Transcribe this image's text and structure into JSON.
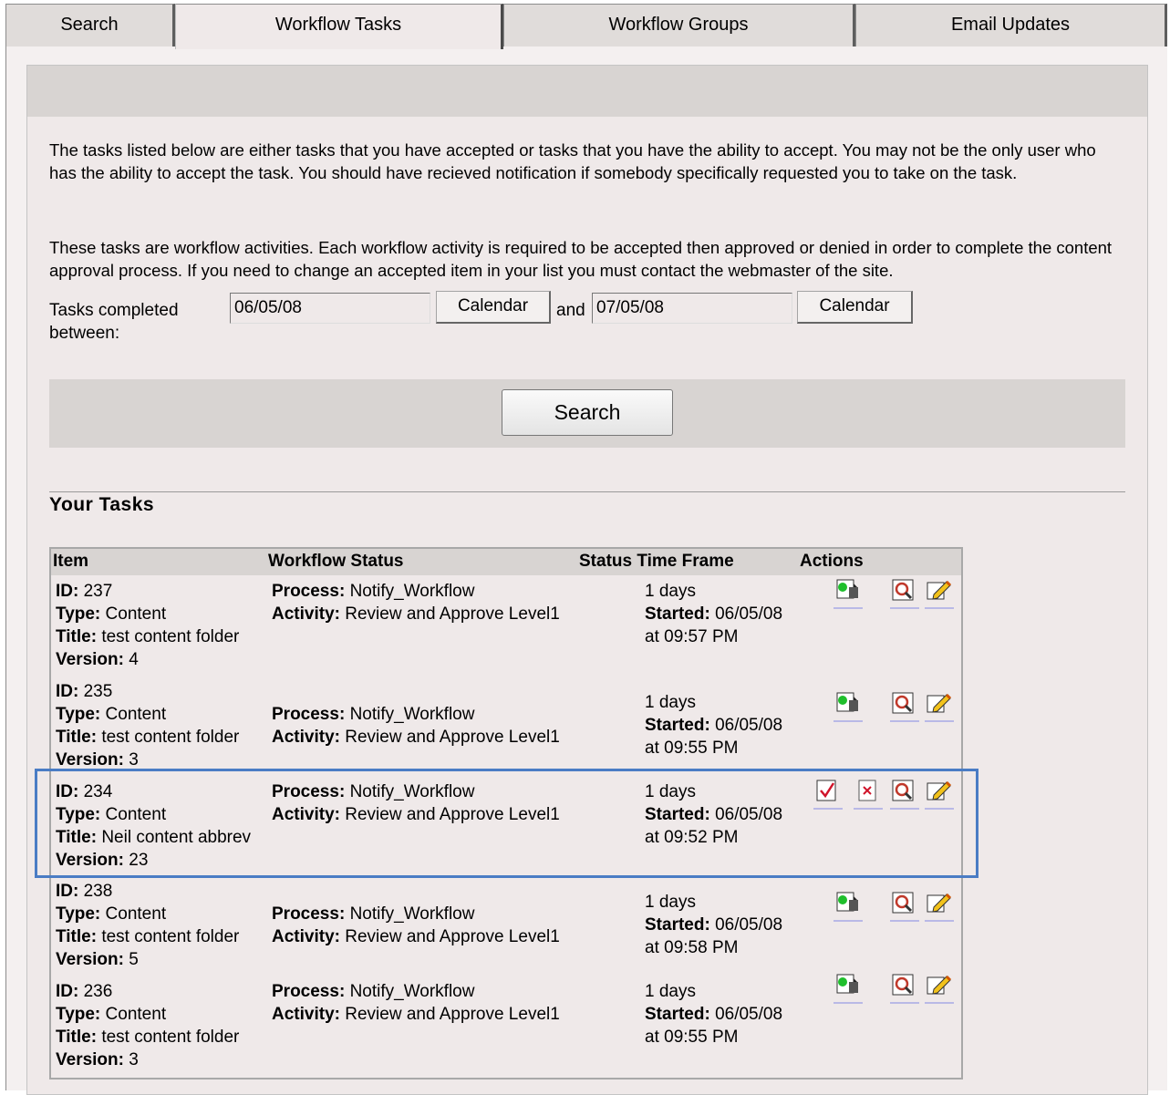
{
  "tabs": [
    {
      "label": "Search",
      "active": false
    },
    {
      "label": "Workflow Tasks",
      "active": true
    },
    {
      "label": "Workflow Groups",
      "active": false
    },
    {
      "label": "Email Updates",
      "active": false
    }
  ],
  "intro": {
    "paragraph1": "The tasks listed below are either tasks that you have accepted or tasks that you have the ability to accept. You may not be the only user who has the ability to accept the task. You should have recieved notification if somebody specifically requested you to take on the task.",
    "paragraph2": "These tasks are workflow activities. Each workflow activity is required to be accepted then approved or denied in order to complete the content approval process. If you need to change an accepted item in your list you must contact the webmaster of the site."
  },
  "date_range": {
    "label": "Tasks completed between:",
    "from_value": "06/05/08",
    "to_value": "07/05/08",
    "calendar_label": "Calendar",
    "and_label": "and"
  },
  "search_button": "Search",
  "section_title": "Your Tasks",
  "table": {
    "headers": {
      "item": "Item",
      "status": "Workflow Status",
      "timeframe": "Status Time Frame",
      "actions": "Actions"
    },
    "field_labels": {
      "id": "ID:",
      "type": "Type:",
      "title": "Title:",
      "version": "Version:",
      "process": "Process:",
      "activity": "Activity:",
      "started": "Started:"
    },
    "rows": [
      {
        "id": "237",
        "type": "Content",
        "title": "test content folder",
        "version": "4",
        "process": "Notify_Workflow",
        "activity": "Review and Approve Level1",
        "days": "1 days",
        "started": "06/05/08",
        "time": "at 09:57 PM",
        "actions": [
          "accept-task-icon",
          "preview-icon",
          "edit-icon"
        ]
      },
      {
        "id": "235",
        "type": "Content",
        "title": "test content folder",
        "version": "3",
        "process": "Notify_Workflow",
        "activity": "Review and Approve Level1",
        "days": "1 days",
        "started": "06/05/08",
        "time": "at 09:55 PM",
        "actions": [
          "accept-task-icon",
          "preview-icon",
          "edit-icon"
        ]
      },
      {
        "id": "234",
        "type": "Content",
        "title": "Neil content abbrev",
        "version": "23",
        "process": "Notify_Workflow",
        "activity": "Review and Approve Level1",
        "days": "1 days",
        "started": "06/05/08",
        "time": "at 09:52 PM",
        "actions": [
          "approve-icon",
          "deny-icon",
          "preview-icon",
          "edit-icon"
        ]
      },
      {
        "id": "238",
        "type": "Content",
        "title": "test content folder",
        "version": "5",
        "process": "Notify_Workflow",
        "activity": "Review and Approve Level1",
        "days": "1 days",
        "started": "06/05/08",
        "time": "at 09:58 PM",
        "actions": [
          "accept-task-icon",
          "preview-icon",
          "edit-icon"
        ]
      },
      {
        "id": "236",
        "type": "Content",
        "title": "test content folder",
        "version": "3",
        "process": "Notify_Workflow",
        "activity": "Review and Approve Level1",
        "days": "1 days",
        "started": "06/05/08",
        "time": "at 09:55 PM",
        "actions": [
          "accept-task-icon",
          "preview-icon",
          "edit-icon"
        ]
      }
    ]
  },
  "colors": {
    "highlight_border": "#4a7cc4",
    "panel_bg": "#efe9e9",
    "bar_bg": "#d8d4d2"
  }
}
